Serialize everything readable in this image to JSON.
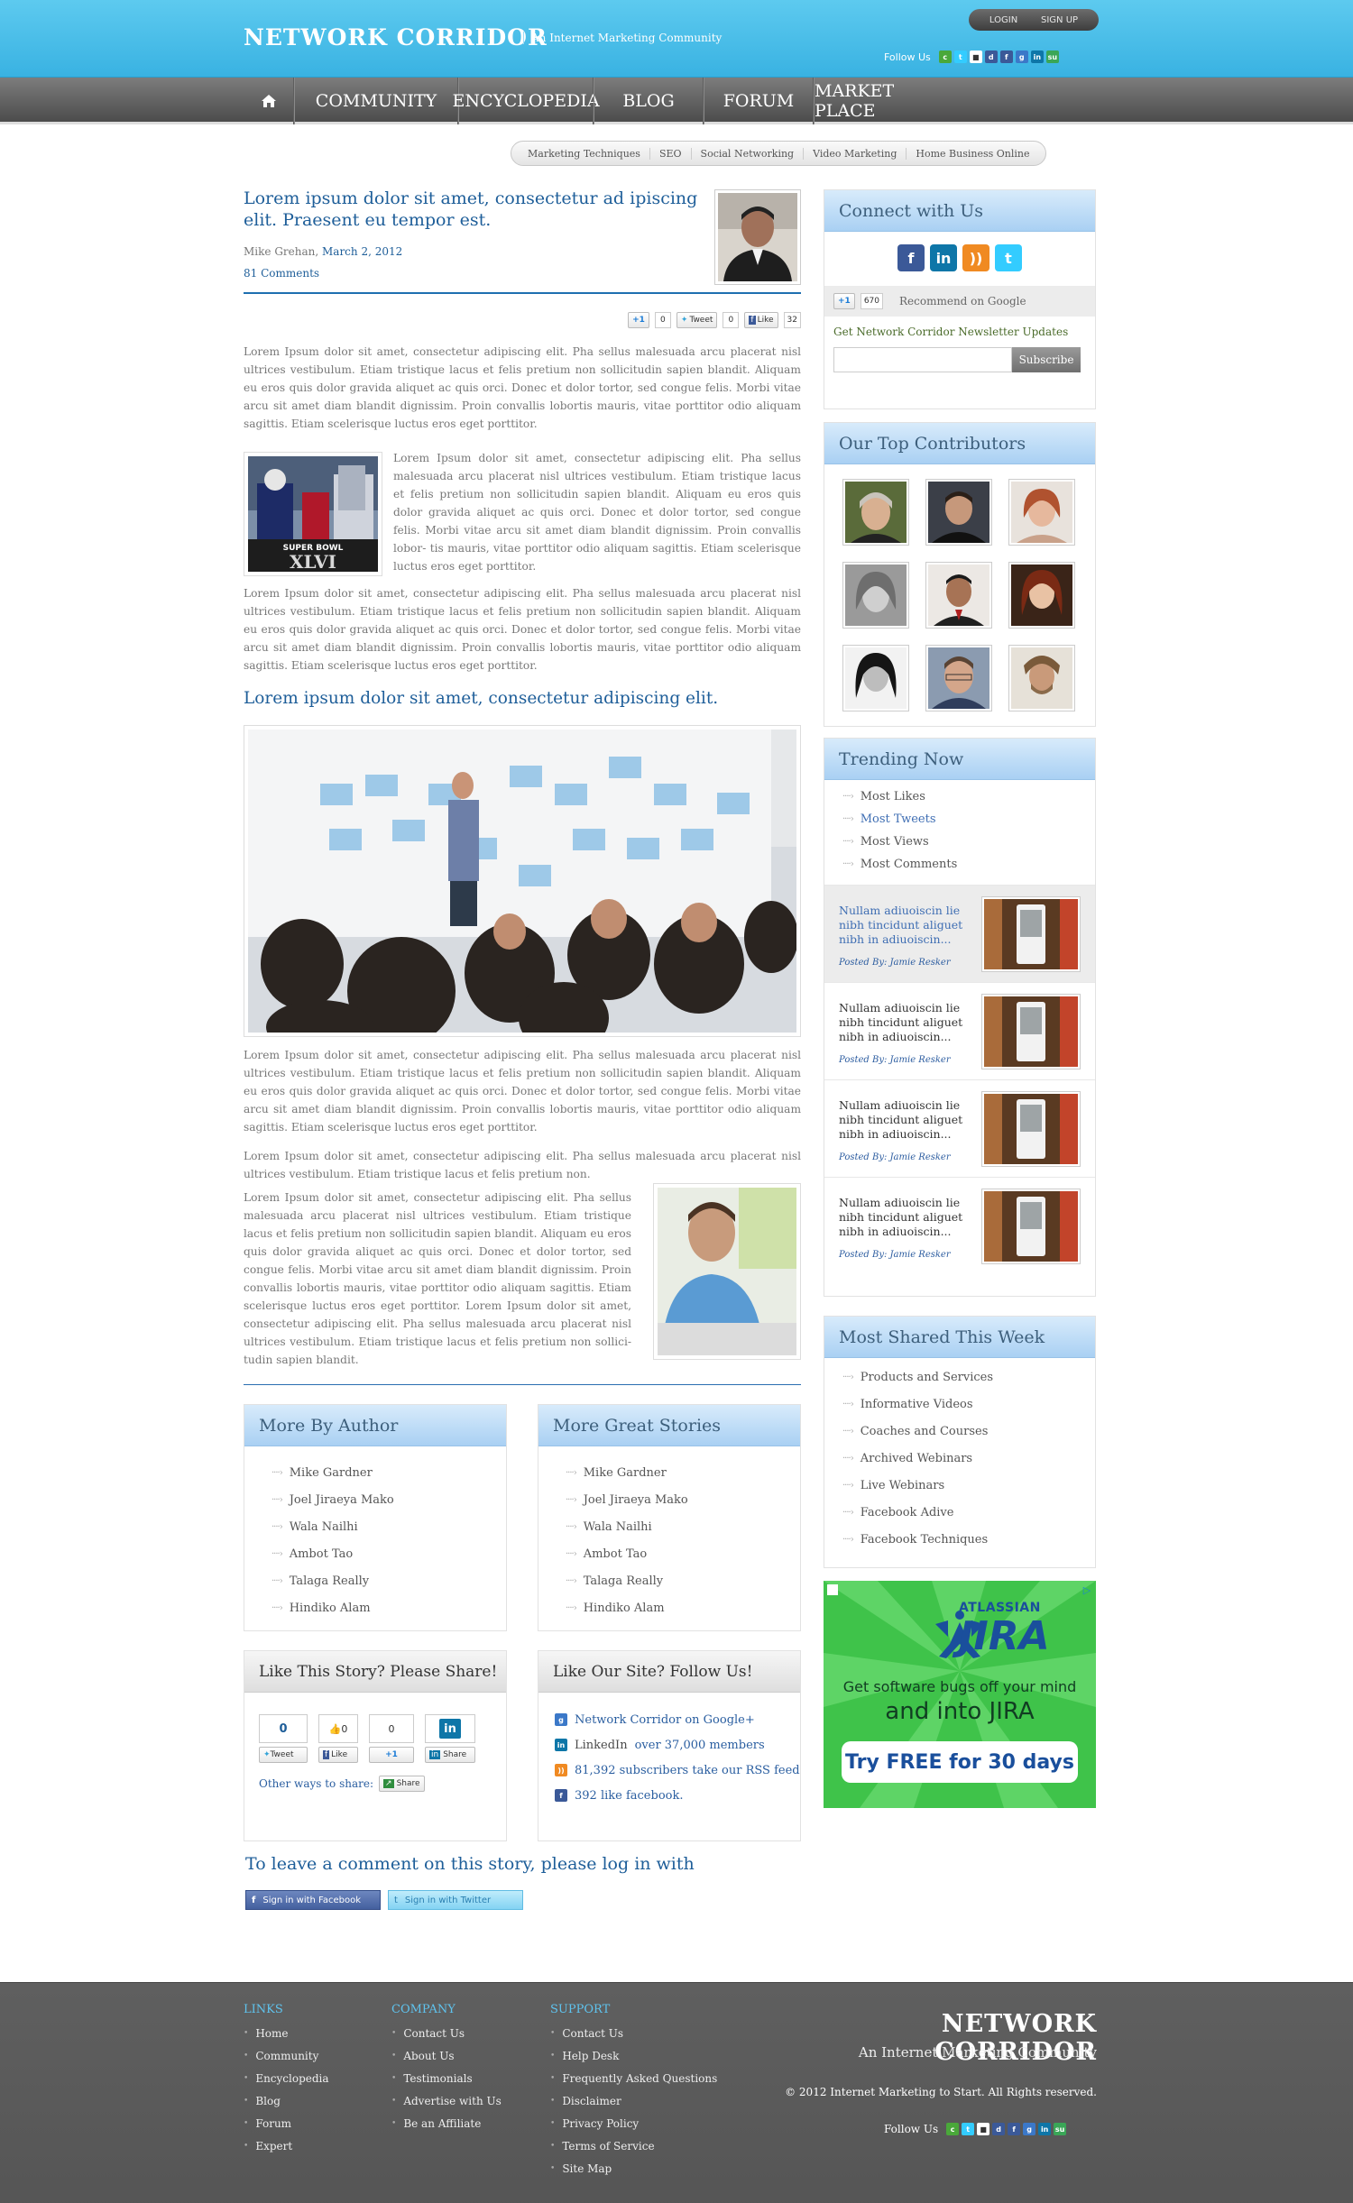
{
  "header": {
    "logo": "NETWORK CORRIDOR",
    "tagline": "An Internet Marketing Community",
    "login": "LOGIN",
    "signup": "SIGN UP",
    "follow_label": "Follow Us"
  },
  "nav": {
    "items": [
      "COMMUNITY",
      "ENCYCLOPEDIA",
      "BLOG",
      "FORUM",
      "MARKET PLACE"
    ]
  },
  "subnav": [
    "Marketing Techniques",
    "SEO",
    "Social Networking",
    "Video Marketing",
    "Home Business Online"
  ],
  "article": {
    "title": "Lorem ipsum dolor sit amet, consectetur ad ipiscing elit. Praesent eu tempor est.",
    "author": "Mike Grehan,",
    "date": "March 2, 2012",
    "comments": "81 Comments",
    "share": {
      "gplus": "+1",
      "gplus_count": "0",
      "tweet": "Tweet",
      "tweet_count": "0",
      "like": "Like",
      "like_count": "32"
    },
    "p1": "Lorem Ipsum dolor sit amet, consectetur adipiscing elit. Pha sellus malesuada arcu placerat nisl ultrices vestibulum. Etiam tristique lacus et felis pretium non sollicitudin sapien blandit. Aliquam eu eros quis dolor gravida aliquet ac quis orci. Donec et dolor tortor, sed congue felis. Morbi vitae arcu sit amet diam blandit dignissim. Proin convallis lobortis mauris, vitae porttitor odio aliquam sagittis.  Etiam scelerisque luctus eros eget porttitor.",
    "p2": "Lorem Ipsum dolor sit amet, consectetur adipiscing elit. Pha sellus malesuada arcu placerat nisl ultrices vestibulum. Etiam tristique lacus et felis pretium non sollicitudin sapien blandit. Aliquam eu eros quis dolor gravida aliquet ac quis orci. Donec et dolor tortor, sed congue felis. Morbi vitae arcu sit amet diam blandit dignissim. Proin convallis lobor- tis mauris, vitae porttitor odio aliquam sagittis. Etiam scelerisque luctus eros eget porttitor.",
    "p3": "Lorem Ipsum dolor sit amet, consectetur adipiscing elit. Pha sellus malesuada arcu placerat nisl ultrices vestibulum. Etiam tristique lacus et felis pretium non sollicitudin sapien blandit. Aliquam eu eros quis dolor gravida aliquet ac quis orci. Donec et dolor tortor, sed congue felis. Morbi vitae arcu sit amet diam blandit dignissim. Proin convallis lobortis mauris, vitae porttitor odio aliquam sagittis.  Etiam scelerisque luctus eros eget porttitor.",
    "subtitle": "Lorem ipsum dolor sit amet, consectetur adipiscing elit.",
    "p4": "Lorem Ipsum dolor sit amet, consectetur adipiscing elit. Pha sellus malesuada arcu placerat nisl ultrices vestibulum. Etiam tristique lacus et felis pretium non sollicitudin sapien blandit. Aliquam eu eros quis dolor gravida aliquet ac quis orci. Donec et dolor tortor, sed congue felis. Morbi vitae arcu sit amet diam blandit dignissim. Proin convallis lobortis mauris, vitae porttitor odio aliquam sagittis.  Etiam scelerisque luctus eros eget porttitor.",
    "p5": "Lorem Ipsum dolor sit amet, consectetur adipiscing elit. Pha sellus malesuada arcu placerat nisl ultrices vestibulum. Etiam tristique lacus et felis pretium non.",
    "p6": "Lorem Ipsum dolor sit amet, consectetur adipiscing elit. Pha sellus malesuada arcu placerat nisl ultrices vestibulum. Etiam tristique lacus et felis pretium non sollicitudin sapien blandit. Aliquam eu eros quis dolor gravida aliquet ac quis orci. Donec et dolor tortor, sed congue felis. Morbi vitae arcu sit amet diam blandit dignissim. Proin convallis lobortis mauris, vitae porttitor odio aliquam sagittis.  Etiam scelerisque luctus eros eget porttitor.  Lorem Ipsum dolor sit amet, consectetur adipiscing elit. Pha sellus malesuada arcu placerat nisl ultrices vestibulum. Etiam tristique lacus et felis pretium non sollici- tudin sapien blandit.",
    "superbowl_text": "SUPER BOWL XLVI"
  },
  "more_by_author": {
    "title": "More By Author",
    "items": [
      "Mike Gardner",
      "Joel Jiraeya Mako",
      "Wala Nailhi",
      "Ambot  Tao",
      "Talaga Really",
      "Hindiko Alam"
    ]
  },
  "more_stories": {
    "title": "More Great Stories",
    "items": [
      "Mike Gardner",
      "Joel Jiraeya Mako",
      "Wala Nailhi",
      "Ambot  Tao",
      "Talaga Really",
      "Hindiko Alam"
    ]
  },
  "share_box": {
    "title": "Like This Story? Please Share!",
    "tweet_count": "0",
    "tweet": "Tweet",
    "like_count": "0",
    "like": "Like",
    "gplus_count": "0",
    "gplus": "+1",
    "share": "Share",
    "other_ways": "Other ways to share:",
    "share_btn": "Share"
  },
  "follow_box": {
    "title": "Like Our Site? Follow Us!",
    "gplus": "Network Corridor on Google+",
    "linkedin_pre": "LinkedIn",
    "linkedin": "over 37,000 members",
    "rss": "81,392 subscribers take our RSS feed",
    "facebook": "392 like facebook."
  },
  "login_prompt": {
    "title": "To leave a comment on this story, please log in with",
    "facebook": "Sign in with Facebook",
    "twitter": "Sign in with Twitter"
  },
  "sidebar": {
    "connect": {
      "title": "Connect with  Us",
      "gplus": "+1",
      "gplus_count": "670",
      "recommend": "Recommend on Google",
      "newsletter": "Get Network Corridor Newsletter Updates",
      "subscribe": "Subscribe"
    },
    "contributors": {
      "title": "Our Top Contributors"
    },
    "trending": {
      "title": "Trending Now",
      "tabs": [
        "Most Likes",
        "Most Tweets",
        "Most Views",
        "Most Comments"
      ],
      "items": [
        {
          "text": "Nullam adiuoiscin lie nibh  tincidunt aliguet nibh in adiuoiscin...",
          "by": "Posted By: Jamie Resker"
        },
        {
          "text": "Nullam adiuoiscin lie nibh  tincidunt aliguet nibh in adiuoiscin...",
          "by": "Posted By: Jamie Resker"
        },
        {
          "text": "Nullam adiuoiscin lie nibh  tincidunt aliguet nibh in adiuoiscin...",
          "by": "Posted By: Jamie Resker"
        },
        {
          "text": "Nullam adiuoiscin lie nibh  tincidunt aliguet nibh in adiuoiscin...",
          "by": "Posted By: Jamie Resker"
        }
      ]
    },
    "most_shared": {
      "title": "Most Shared This Week",
      "items": [
        "Products and Services",
        "Informative Videos",
        "Coaches and Courses",
        "Archived Webinars",
        "Live Webinars",
        "Facebook Adive",
        "Facebook Techniques"
      ]
    },
    "ad": {
      "brand_small": "ATLASSIAN",
      "brand": "JIRA",
      "line1": "Get software bugs off your mind",
      "line2": "and into JIRA",
      "cta": "Try FREE for 30 days"
    }
  },
  "footer": {
    "links": {
      "title": "LINKS",
      "items": [
        "Home",
        "Community",
        "Encyclopedia",
        "Blog",
        "Forum",
        "Expert"
      ]
    },
    "company": {
      "title": "COMPANY",
      "items": [
        "Contact Us",
        "About Us",
        "Testimonials",
        "Advertise with Us",
        "Be an Affiliate"
      ]
    },
    "support": {
      "title": "SUPPORT",
      "items": [
        "Contact Us",
        "Help Desk",
        "Frequently Asked Questions",
        "Disclaimer",
        "Privacy Policy",
        "Terms of Service",
        "Site Map"
      ]
    },
    "logo": "NETWORK CORRIDOR",
    "tagline": "An Internet Marketing Community",
    "copyright": "© 2012 Internet Marketing to Start. All Rights reserved.",
    "follow_label": "Follow Us"
  },
  "colors": {
    "header": "#39b2e2",
    "nav": "#5e5e5e",
    "link": "#1e5e99",
    "box_head": "#a9d0f3",
    "footer": "#5a5a5a"
  }
}
